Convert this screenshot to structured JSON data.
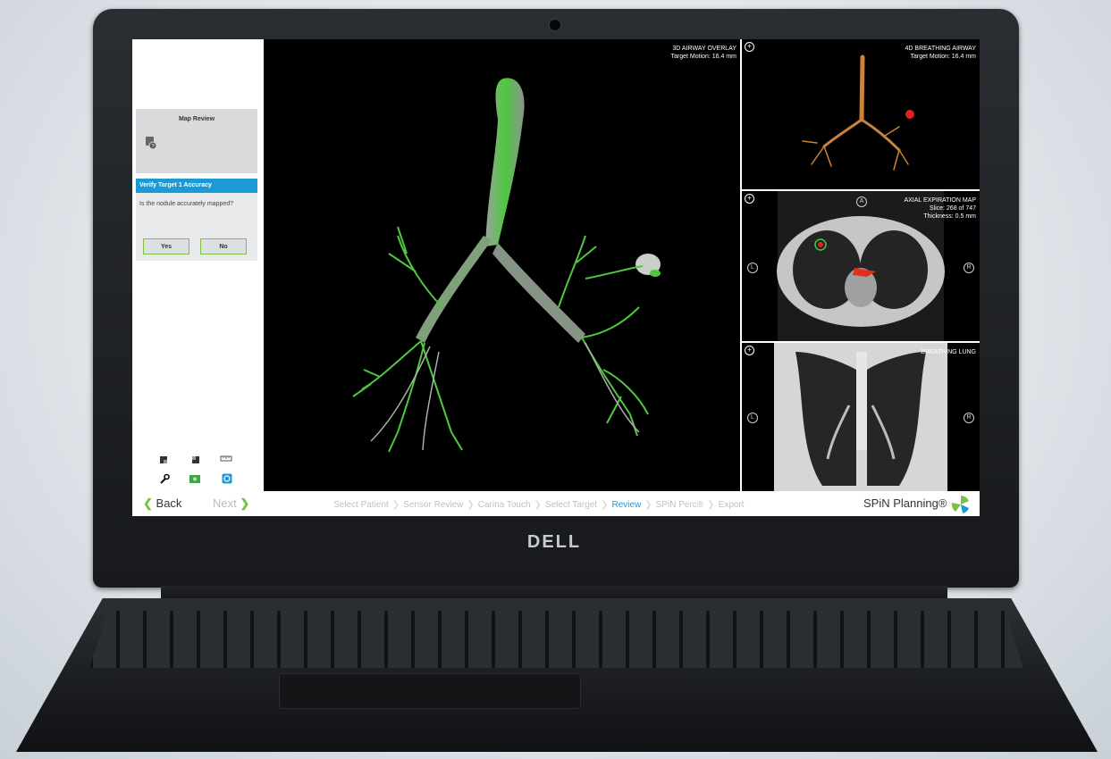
{
  "device": {
    "logo": "DELL"
  },
  "sidebar": {
    "map_review": {
      "title": "Map Review"
    },
    "verify": {
      "header": "Verify Target 1 Accuracy",
      "question": "Is the nodule accurately mapped?",
      "yes_label": "Yes",
      "no_label": "No"
    },
    "tools": [
      "view-icon",
      "view-icon",
      "ruler-icon",
      "wrench-icon",
      "map-icon",
      "target-icon"
    ]
  },
  "nav": {
    "back_label": "Back",
    "next_label": "Next"
  },
  "main_view": {
    "title": "3D AIRWAY OVERLAY",
    "subtitle": "Target Motion: 16.4 mm"
  },
  "tile_4d": {
    "title": "4D BREATHING AIRWAY",
    "subtitle": "Target Motion: 16.4 mm"
  },
  "tile_axial": {
    "title": "AXIAL EXPIRATION MAP",
    "line2": "Slice: 268 of 747",
    "line3": "Thickness: 0.5 mm",
    "marker_a": "A",
    "marker_l": "L",
    "marker_r": "R"
  },
  "tile_coronal": {
    "title": "BREATHING LUNG",
    "marker_l": "L",
    "marker_r": "R"
  },
  "breadcrumb": [
    "Select Patient",
    "Sensor Review",
    "Carina Touch",
    "Select Target",
    "Review",
    "SPiN Perc®",
    "Export"
  ],
  "breadcrumb_active_index": 4,
  "brand": {
    "name": "SPiN Planning®"
  },
  "colors": {
    "accent": "#1c9ad6",
    "green": "#7ac142",
    "airway_green": "#4fc840",
    "airway_orange": "#c8843a",
    "target_red": "#e02020"
  }
}
